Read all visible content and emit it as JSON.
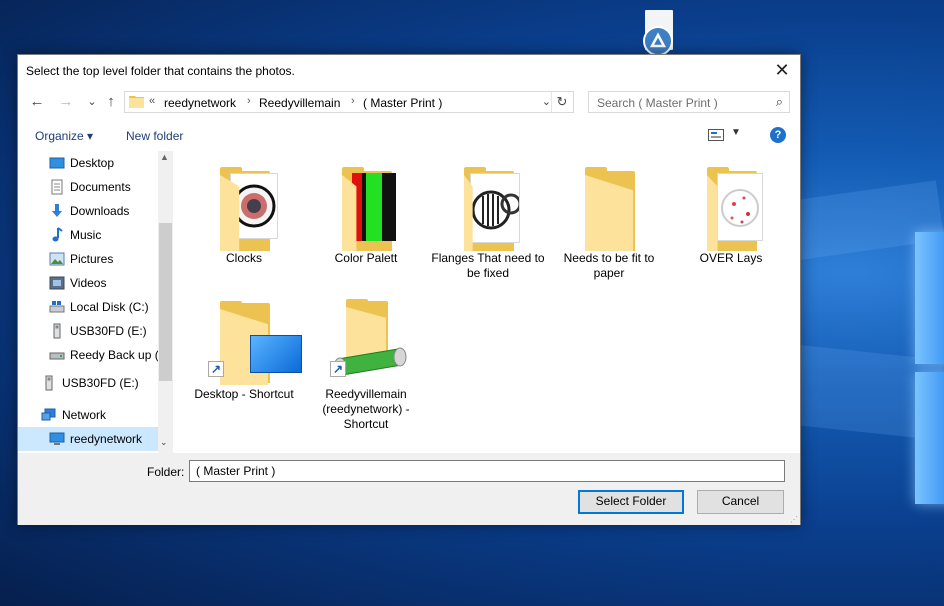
{
  "dialog": {
    "title": "Select the top level folder that contains the photos.",
    "close_glyph": "✕"
  },
  "nav": {
    "back_glyph": "←",
    "forward_glyph": "→",
    "recent_glyph": "⌄",
    "up_glyph": "↑",
    "breadcrumb_overflow": "«",
    "breadcrumbs": [
      "reedynetwork",
      "Reedyvillemain",
      "( Master Print )"
    ],
    "separator": "›",
    "refresh_glyph": "↻",
    "search_placeholder": "Search ( Master Print )",
    "search_glyph": "⌕"
  },
  "toolbar": {
    "organize_label": "Organize ▾",
    "new_folder_label": "New folder",
    "view_dropdown_glyph": "▼",
    "help_glyph": "?"
  },
  "sidebar": {
    "items": [
      {
        "label": "Desktop",
        "icon": "desktop-icon"
      },
      {
        "label": "Documents",
        "icon": "documents-icon"
      },
      {
        "label": "Downloads",
        "icon": "downloads-icon"
      },
      {
        "label": "Music",
        "icon": "music-icon"
      },
      {
        "label": "Pictures",
        "icon": "pictures-icon"
      },
      {
        "label": "Videos",
        "icon": "videos-icon"
      },
      {
        "label": "Local Disk (C:)",
        "icon": "local-disk-icon"
      },
      {
        "label": "USB30FD (E:)",
        "icon": "usb-drive-icon"
      },
      {
        "label": "Reedy Back up (I",
        "icon": "external-drive-icon"
      },
      {
        "label": "USB30FD (E:)",
        "icon": "usb-drive-icon"
      },
      {
        "label": "Network",
        "icon": "network-icon"
      },
      {
        "label": "reedynetwork",
        "icon": "computer-icon",
        "selected": true
      }
    ],
    "scroll_up_glyph": "▲",
    "scroll_down_glyph": "⌄"
  },
  "folders": [
    {
      "label": "Clocks"
    },
    {
      "label": "Color Palett"
    },
    {
      "label": "Flanges That need to be fixed"
    },
    {
      "label": "Needs to be fit to paper"
    },
    {
      "label": "OVER Lays"
    },
    {
      "label": "Desktop - Shortcut"
    },
    {
      "label": "Reedyvillemain (reedynetwork) - Shortcut"
    }
  ],
  "shortcut_glyph": "↗",
  "footer": {
    "folder_label": "Folder:",
    "folder_value": "( Master Print )",
    "select_button": "Select Folder",
    "cancel_button": "Cancel"
  },
  "colors": {
    "accent": "#0078d7",
    "folder": "#ecc351",
    "selection": "#cce8ff"
  }
}
